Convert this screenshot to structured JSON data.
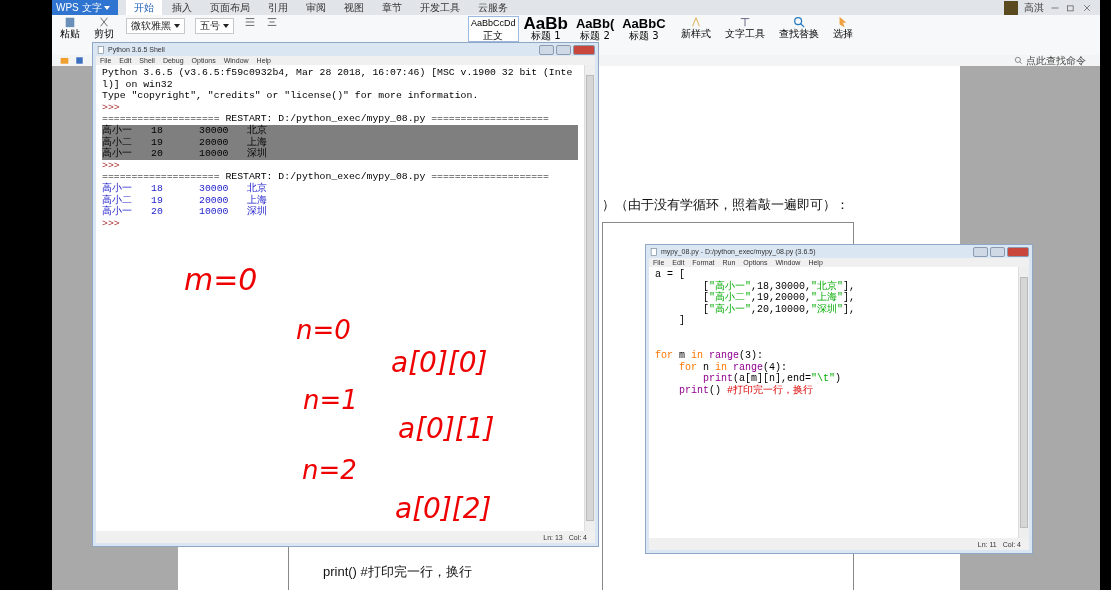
{
  "app_bar": {
    "app_button": "WPS 文字",
    "user": "高淇",
    "tabs": [
      {
        "label": "开始",
        "selected": true
      },
      {
        "label": "插入",
        "selected": false
      },
      {
        "label": "页面布局",
        "selected": false
      },
      {
        "label": "引用",
        "selected": false
      },
      {
        "label": "审阅",
        "selected": false
      },
      {
        "label": "视图",
        "selected": false
      },
      {
        "label": "章节",
        "selected": false
      },
      {
        "label": "开发工具",
        "selected": false
      },
      {
        "label": "云服务",
        "selected": false
      }
    ]
  },
  "ribbon": {
    "paste": "粘贴",
    "cut": "剪切",
    "font": "微软雅黑",
    "size": "五号",
    "styles": [
      {
        "sample": "AaBbCcDd",
        "label": "正文",
        "kind": "small"
      },
      {
        "sample": "AaBb",
        "label": "标题 1",
        "kind": "large"
      },
      {
        "sample": "AaBb(",
        "label": "标题 2",
        "kind": "medium"
      },
      {
        "sample": "AaBbC",
        "label": "标题 3",
        "kind": "medium"
      }
    ],
    "new_style": "新样式",
    "tools": [
      "文字工具",
      "查找替换",
      "选择"
    ],
    "command_search": "点此查找命令"
  },
  "document": {
    "fragment": "）（由于没有学循环，照着敲一遍即可）：",
    "code_line": "print() #打印完一行，换行"
  },
  "shell_window": {
    "title": "Python 3.6.5 Shell",
    "menu": [
      "File",
      "Edit",
      "Shell",
      "Debug",
      "Options",
      "Window",
      "Help"
    ],
    "lines": [
      {
        "kind": "banner",
        "text": "Python 3.6.5 (v3.6.5:f59c0932b4, Mar 28 2018, 16:07:46) [MSC v.1900 32 bit (Inte"
      },
      {
        "kind": "banner",
        "text": "l)] on win32"
      },
      {
        "kind": "banner",
        "text": "Type \"copyright\", \"credits\" or \"license()\" for more information."
      },
      {
        "kind": "prompt",
        "text": ">>>"
      },
      {
        "kind": "restart",
        "text": "==================== RESTART: D:/python_exec/mypy_08.py ===================="
      },
      {
        "kind": "output",
        "selected": true,
        "cells": [
          "高小一",
          "18",
          "30000",
          "北京"
        ]
      },
      {
        "kind": "output",
        "selected": true,
        "cells": [
          "高小二",
          "19",
          "20000",
          "上海"
        ]
      },
      {
        "kind": "output",
        "selected": true,
        "cells": [
          "高小一",
          "20",
          "10000",
          "深圳"
        ]
      },
      {
        "kind": "prompt",
        "text": ">>>"
      },
      {
        "kind": "restart",
        "text": "==================== RESTART: D:/python_exec/mypy_08.py ===================="
      },
      {
        "kind": "output",
        "selected": false,
        "cells": [
          "高小一",
          "18",
          "30000",
          "北京"
        ]
      },
      {
        "kind": "output",
        "selected": false,
        "cells": [
          "高小二",
          "19",
          "20000",
          "上海"
        ]
      },
      {
        "kind": "output",
        "selected": false,
        "cells": [
          "高小一",
          "20",
          "10000",
          "深圳"
        ]
      },
      {
        "kind": "prompt",
        "text": ">>>"
      }
    ],
    "status": [
      "Ln: 13",
      "Col: 4"
    ]
  },
  "annotations": [
    "m=0",
    "n=0",
    "a[0][0]",
    "n=1",
    "a[0][1]",
    "n=2",
    "a[0][2]"
  ],
  "editor_window": {
    "title": "mypy_08.py - D:/python_exec/mypy_08.py (3.6.5)",
    "menu": [
      "File",
      "Edit",
      "Format",
      "Run",
      "Options",
      "Window",
      "Help"
    ],
    "lines": [
      [
        {
          "kind": "plain",
          "text": "a = ["
        }
      ],
      [
        {
          "kind": "plain",
          "text": "        ["
        },
        {
          "kind": "string",
          "text": "\"高小一\""
        },
        {
          "kind": "plain",
          "text": ",18,30000,"
        },
        {
          "kind": "string",
          "text": "\"北京\""
        },
        {
          "kind": "plain",
          "text": "],"
        }
      ],
      [
        {
          "kind": "plain",
          "text": "        ["
        },
        {
          "kind": "string",
          "text": "\"高小二\""
        },
        {
          "kind": "plain",
          "text": ",19,20000,"
        },
        {
          "kind": "string",
          "text": "\"上海\""
        },
        {
          "kind": "plain",
          "text": "],"
        }
      ],
      [
        {
          "kind": "plain",
          "text": "        ["
        },
        {
          "kind": "string",
          "text": "\"高小一\""
        },
        {
          "kind": "plain",
          "text": ",20,10000,"
        },
        {
          "kind": "string",
          "text": "\"深圳\""
        },
        {
          "kind": "plain",
          "text": "],"
        }
      ],
      [
        {
          "kind": "plain",
          "text": "    ]"
        }
      ],
      [
        {
          "kind": "blank"
        }
      ],
      [
        {
          "kind": "blank"
        }
      ],
      [
        {
          "kind": "keyword",
          "text": "for"
        },
        {
          "kind": "plain",
          "text": " m "
        },
        {
          "kind": "keyword",
          "text": "in "
        },
        {
          "kind": "builtin",
          "text": "range"
        },
        {
          "kind": "plain",
          "text": "(3):"
        }
      ],
      [
        {
          "kind": "keyword",
          "text": "    for"
        },
        {
          "kind": "plain",
          "text": " n "
        },
        {
          "kind": "keyword",
          "text": "in "
        },
        {
          "kind": "builtin",
          "text": "range"
        },
        {
          "kind": "plain",
          "text": "(4):"
        }
      ],
      [
        {
          "kind": "builtin",
          "text": "        print"
        },
        {
          "kind": "plain",
          "text": "(a[m][n],end="
        },
        {
          "kind": "string",
          "text": "\"\\t\""
        },
        {
          "kind": "plain",
          "text": ")"
        }
      ],
      [
        {
          "kind": "builtin",
          "text": "    print"
        },
        {
          "kind": "plain",
          "text": "() "
        },
        {
          "kind": "comment",
          "text": "#打印完一行，换行"
        }
      ]
    ],
    "status": [
      "Ln: 11",
      "Col: 4"
    ]
  }
}
